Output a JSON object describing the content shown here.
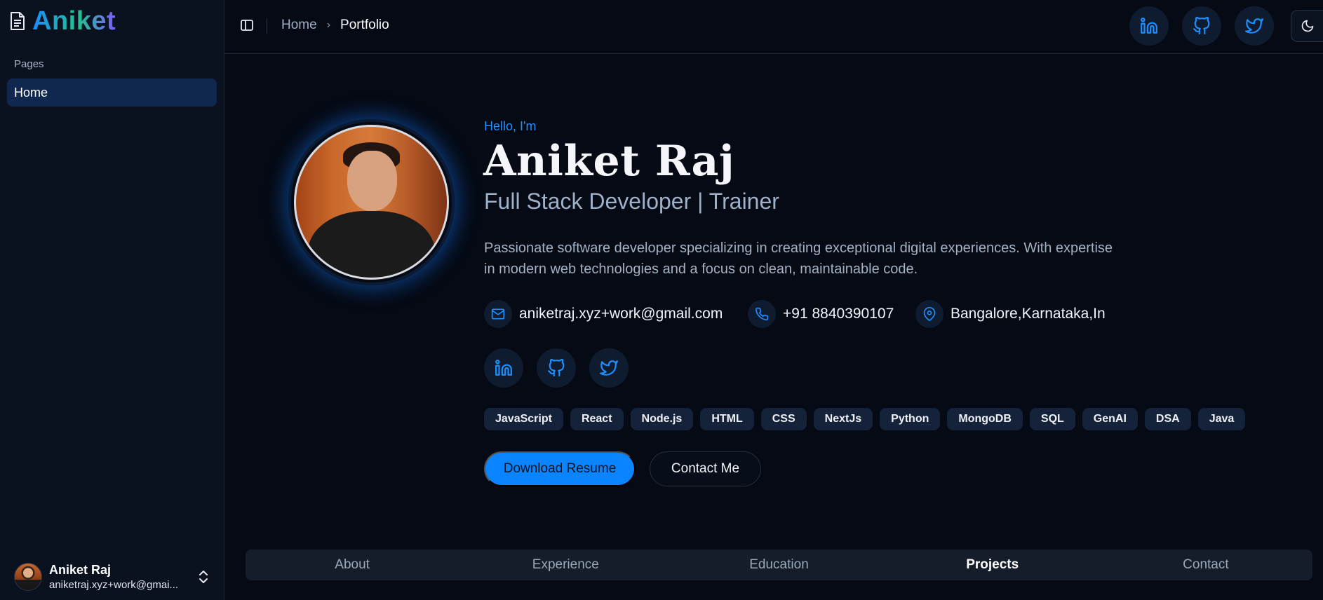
{
  "sidebar": {
    "brand": "Aniket",
    "section_label": "Pages",
    "items": [
      {
        "label": "Home"
      }
    ],
    "user": {
      "name": "Aniket Raj",
      "email": "aniketraj.xyz+work@gmai..."
    }
  },
  "header": {
    "breadcrumb": {
      "home": "Home",
      "separator": "›",
      "current": "Portfolio"
    },
    "icons": [
      "linkedin-icon",
      "github-icon",
      "twitter-icon",
      "moon-icon"
    ]
  },
  "hero": {
    "greeting": "Hello, I'm",
    "name": "Aniket Raj",
    "role": "Full Stack Developer | Trainer",
    "bio": "Passionate software developer specializing in creating exceptional digital experiences. With expertise in modern web technologies and a focus on clean, maintainable code.",
    "email": "aniketraj.xyz+work@gmail.com",
    "phone": "+91 8840390107",
    "location": "Bangalore,Karnataka,In",
    "skills": [
      "JavaScript",
      "React",
      "Node.js",
      "HTML",
      "CSS",
      "NextJs",
      "Python",
      "MongoDB",
      "SQL",
      "GenAI",
      "DSA",
      "Java"
    ],
    "primary_button": "Download Resume",
    "secondary_button": "Contact Me"
  },
  "bottom_nav": {
    "items": [
      "About",
      "Experience",
      "Education",
      "Projects",
      "Contact"
    ],
    "active": "Projects"
  },
  "colors": {
    "accent": "#0a84ff",
    "background": "#050a14",
    "sidebar": "#0a1220",
    "nav_active": "#10284f"
  }
}
